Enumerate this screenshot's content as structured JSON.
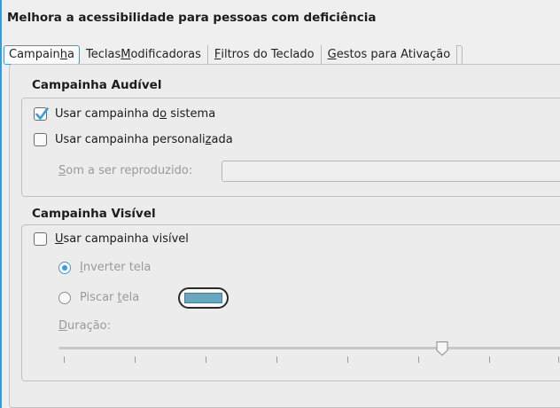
{
  "window": {
    "heading": "Melhora a acessibilidade para pessoas com deficiência"
  },
  "tabs": [
    {
      "pre": "Campain",
      "mn": "h",
      "post": "a",
      "active": true
    },
    {
      "pre": "Teclas ",
      "mn": "M",
      "post": "odificadoras",
      "active": false
    },
    {
      "pre": "",
      "mn": "F",
      "post": "iltros do Teclado",
      "active": false
    },
    {
      "pre": "",
      "mn": "G",
      "post": "estos para Ativação",
      "active": false
    }
  ],
  "audible": {
    "title": "Campainha Audível",
    "system_bell": {
      "pre": "Usar campainha d",
      "mn": "o",
      "post": " sistema",
      "checked": true
    },
    "custom_bell": {
      "pre": "Usar campainha personali",
      "mn": "z",
      "post": "ada",
      "checked": false
    },
    "sound_label": {
      "pre": "",
      "mn": "S",
      "post": "om a ser reproduzido:"
    },
    "sound_value": ""
  },
  "visible": {
    "title": "Campainha Visível",
    "use_visible": {
      "pre": "",
      "mn": "U",
      "post": "sar campainha visível",
      "checked": false
    },
    "invert_screen": {
      "pre": "",
      "mn": "I",
      "post": "nverter tela",
      "selected": true
    },
    "flash_screen": {
      "pre": "Piscar ",
      "mn": "t",
      "post": "ela",
      "selected": false
    },
    "flash_color": "#66a6bf",
    "duration_label": {
      "pre": "",
      "mn": "D",
      "post": "uração:"
    },
    "duration_fraction": 0.76
  },
  "colors": {
    "accent": "#3c9bd6",
    "disabled_text": "#9a9a9a"
  }
}
